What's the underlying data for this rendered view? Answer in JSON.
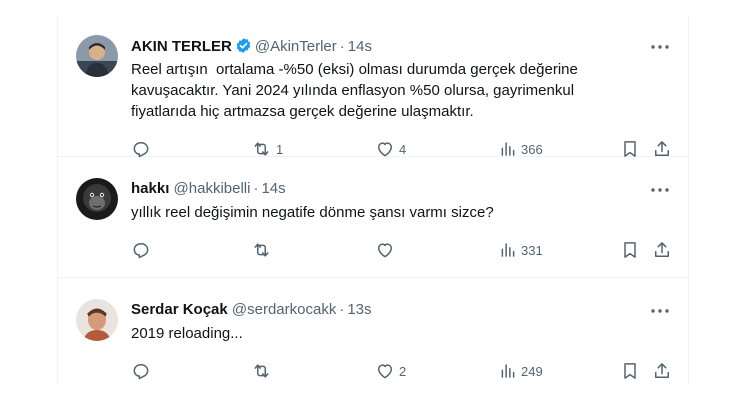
{
  "colors": {
    "icon": "#536471",
    "verified": "#1d9bf0",
    "text": "#0f1419",
    "border": "#eff3f4"
  },
  "tweets": [
    {
      "name": "AKIN TERLER",
      "verified": true,
      "handle": "@AkinTerler",
      "separator": "·",
      "time": "14s",
      "text": "Reel artışın  ortalama -%50 (eksi) olması durumda gerçek değerine\nkavuşacaktır. Yani 2024 yılında enflasyon %50 olursa, gayrimenkul\nfiyatlarıda hiç artmazsa gerçek değerine ulaşmaktır.",
      "replies": "",
      "retweets": "1",
      "likes": "4",
      "views": "366"
    },
    {
      "name": "hakkı",
      "verified": false,
      "handle": "@hakkibelli",
      "separator": "·",
      "time": "14s",
      "text": "yıllık reel değişimin negatife dönme şansı varmı sizce?",
      "replies": "",
      "retweets": "",
      "likes": "",
      "views": "331"
    },
    {
      "name": "Serdar Koçak",
      "verified": false,
      "handle": "@serdarkocakk",
      "separator": "·",
      "time": "13s",
      "text": "2019 reloading...",
      "replies": "",
      "retweets": "",
      "likes": "2",
      "views": "249"
    }
  ]
}
